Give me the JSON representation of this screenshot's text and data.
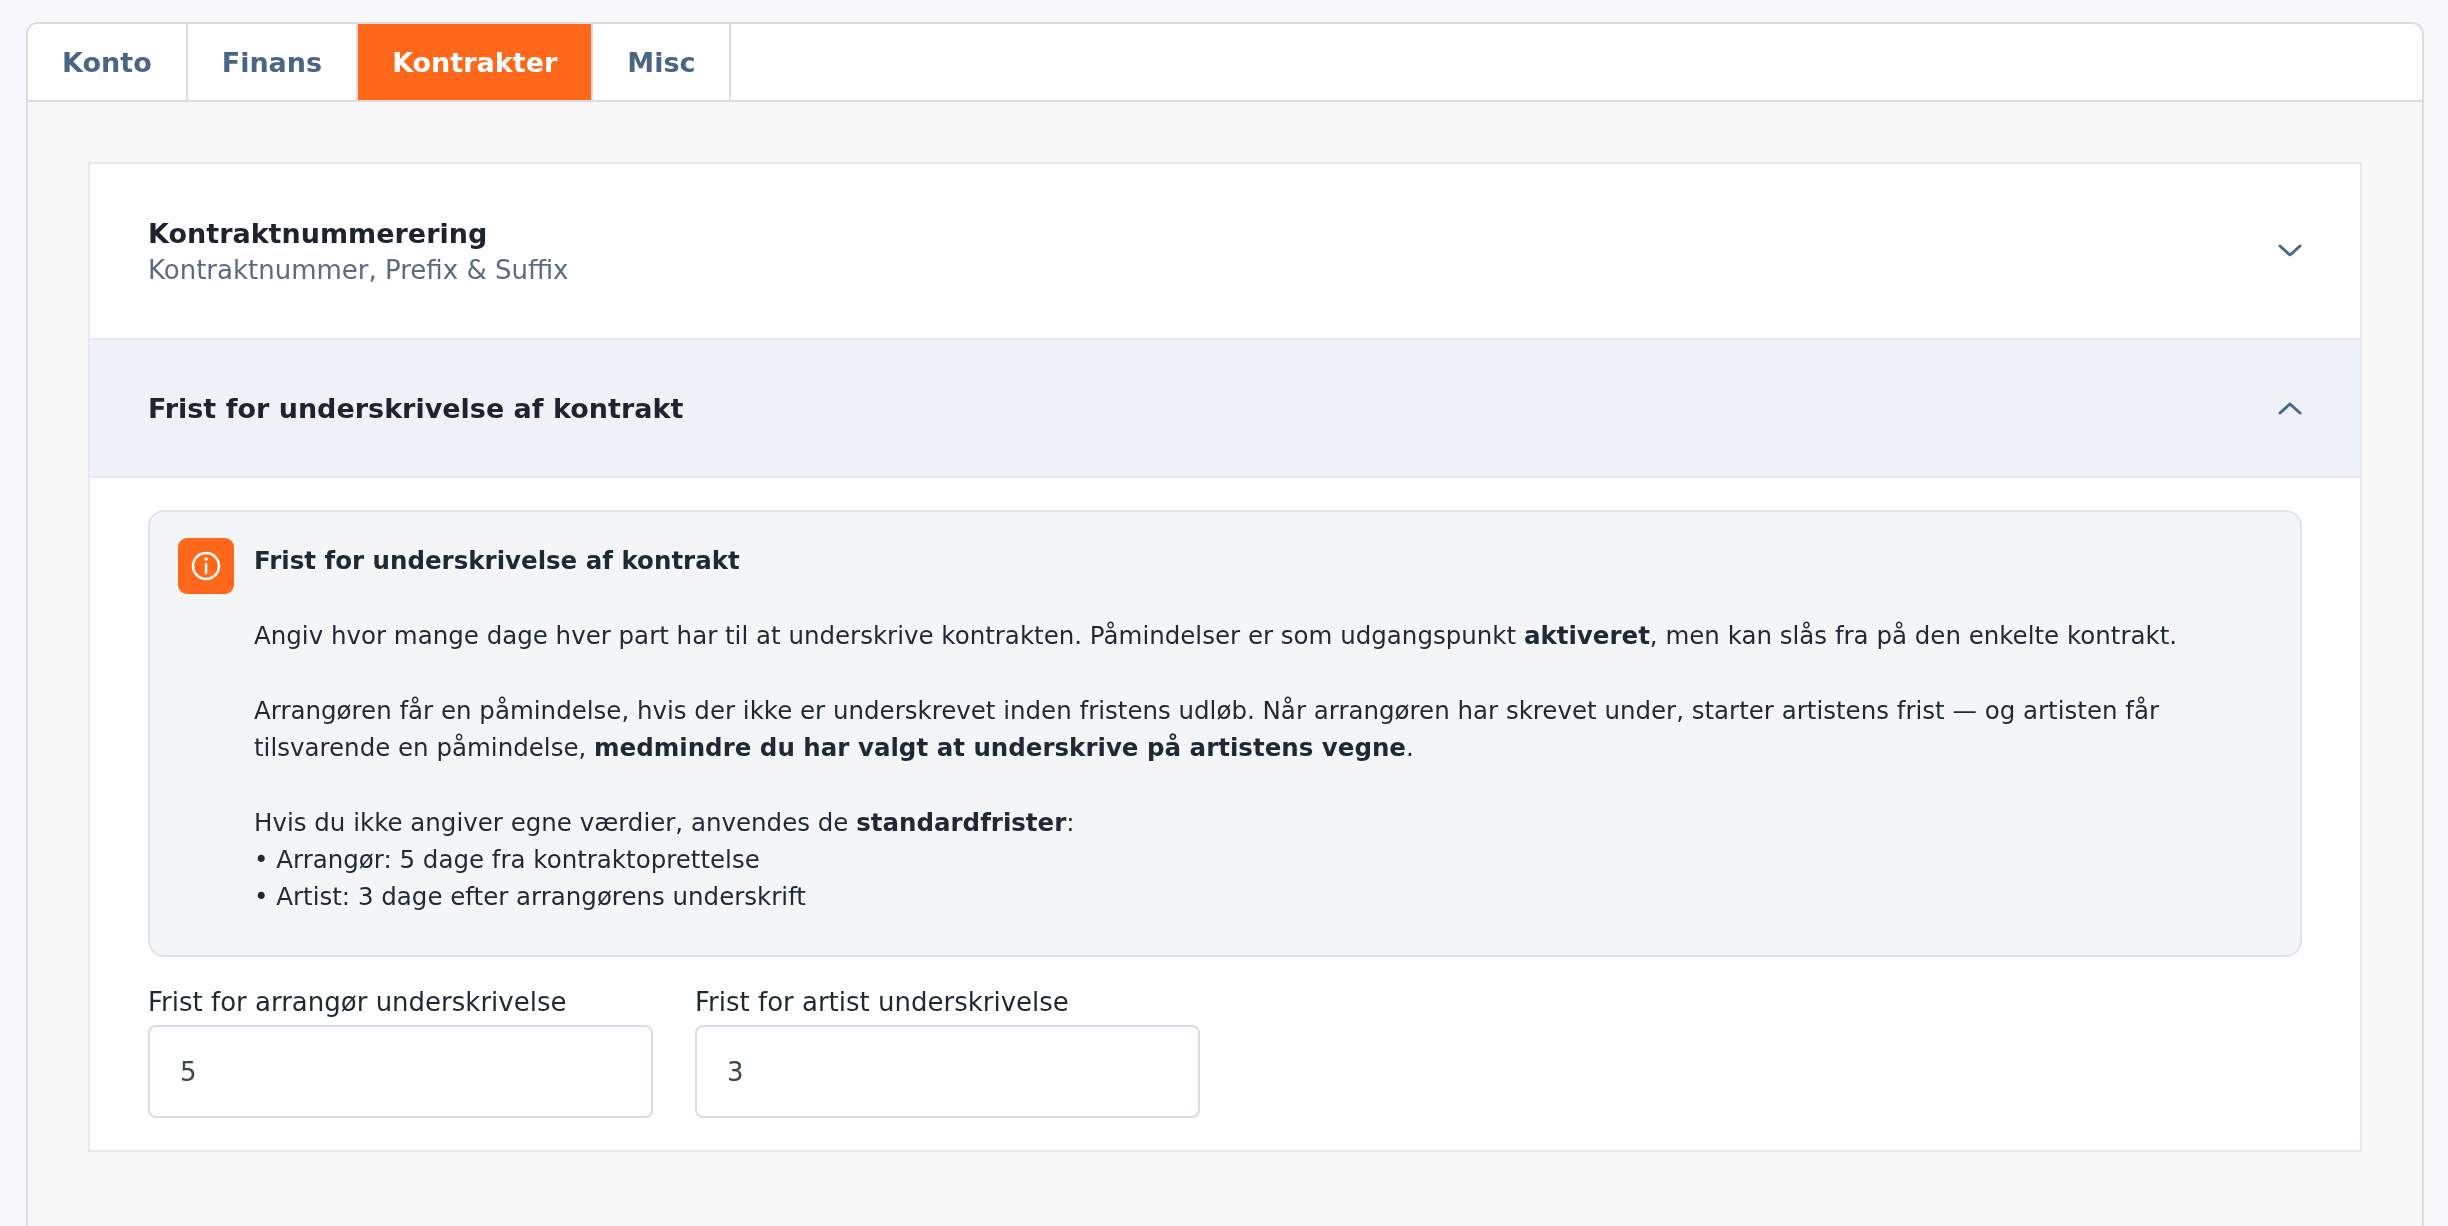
{
  "tabs": [
    {
      "label": "Konto",
      "selected": false
    },
    {
      "label": "Finans",
      "selected": false
    },
    {
      "label": "Kontrakter",
      "selected": true
    },
    {
      "label": "Misc",
      "selected": false
    }
  ],
  "sections": [
    {
      "title": "Kontraktnummerering",
      "subtitle": "Kontraktnummer, Prefix & Suffix",
      "expanded": false
    },
    {
      "title": "Frist for underskrivelse af kontrakt",
      "expanded": true
    }
  ],
  "info": {
    "title": "Frist for underskrivelse af kontrakt",
    "paragraphs": [
      "Angiv hvor mange dage hver part har til at underskrive kontrakten. Påmindelser er som udgangspunkt **aktiveret**, men kan slås fra på den enkelte kontrakt.",
      "Arrangøren får en påmindelse, hvis der ikke er underskrevet inden fristens udløb. Når arrangøren har skrevet under, starter artistens frist — og artisten får tilsvarende en påmindelse, **medmindre du har valgt at underskrive på artistens vegne**.",
      "Hvis du ikke angiver egne værdier, anvendes de **standardfrister**:"
    ],
    "bullets": [
      "• Arrangør: 5 dage fra kontraktoprettelse",
      "• Artist: 3 dage efter arrangørens underskrift"
    ]
  },
  "fields": [
    {
      "label": "Frist for arrangør underskrivelse",
      "value": "5"
    },
    {
      "label": "Frist for artist underskrivelse",
      "value": "3"
    }
  ]
}
